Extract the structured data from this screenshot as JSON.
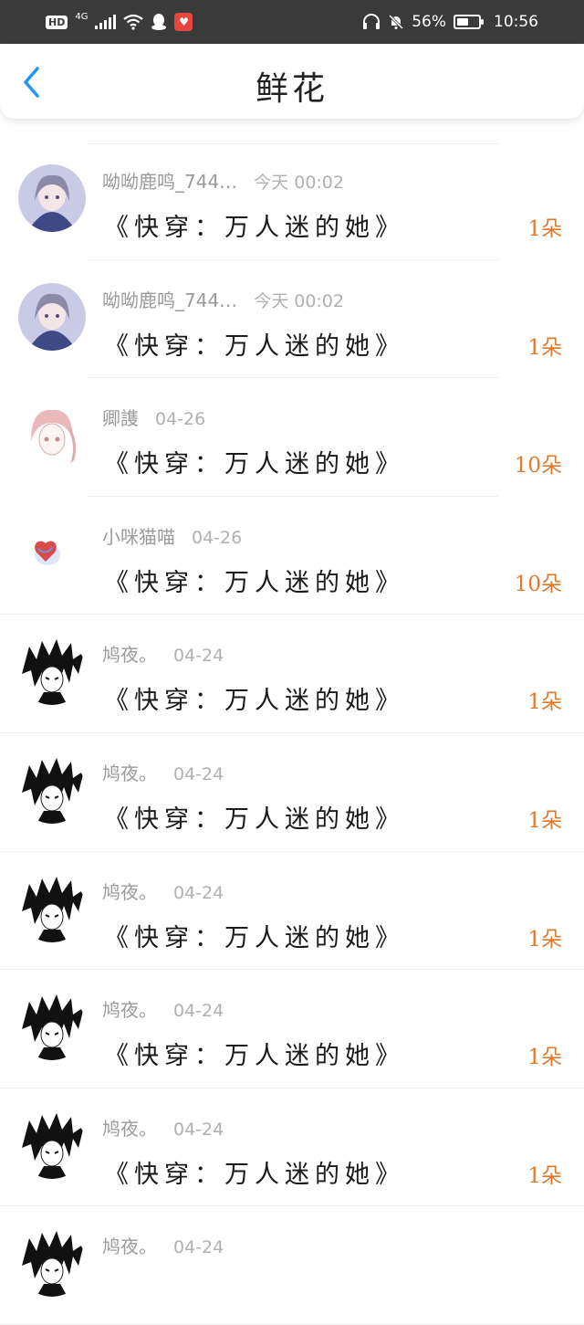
{
  "status_bar": {
    "hd": "HD",
    "network": "4G",
    "battery": "56%",
    "battery_level": 0.56,
    "time": "10:56"
  },
  "header": {
    "title": "鲜花"
  },
  "colors": {
    "accent": "#1e90ff",
    "amount": "#e07a2c"
  },
  "records": [
    {
      "user": "呦呦鹿鸣_744…",
      "time": "今天 00:02",
      "book": "《快穿：万人迷的她》",
      "amount": "1朵",
      "avatar": "anime-girl"
    },
    {
      "user": "呦呦鹿鸣_744…",
      "time": "今天 00:02",
      "book": "《快穿：万人迷的她》",
      "amount": "1朵",
      "avatar": "anime-girl"
    },
    {
      "user": "卿謢",
      "time": "04-26",
      "book": "《快穿：万人迷的她》",
      "amount": "10朵",
      "avatar": "sketch-girl"
    },
    {
      "user": "小咪猫喵",
      "time": "04-26",
      "book": "《快穿：万人迷的她》",
      "amount": "10朵",
      "avatar": "heart"
    },
    {
      "user": "鸠夜。",
      "time": "04-24",
      "book": "《快穿：万人迷的她》",
      "amount": "1朵",
      "avatar": "ink-boy"
    },
    {
      "user": "鸠夜。",
      "time": "04-24",
      "book": "《快穿：万人迷的她》",
      "amount": "1朵",
      "avatar": "ink-boy"
    },
    {
      "user": "鸠夜。",
      "time": "04-24",
      "book": "《快穿：万人迷的她》",
      "amount": "1朵",
      "avatar": "ink-boy"
    },
    {
      "user": "鸠夜。",
      "time": "04-24",
      "book": "《快穿：万人迷的她》",
      "amount": "1朵",
      "avatar": "ink-boy"
    },
    {
      "user": "鸠夜。",
      "time": "04-24",
      "book": "《快穿：万人迷的她》",
      "amount": "1朵",
      "avatar": "ink-boy"
    },
    {
      "user": "鸠夜。",
      "time": "04-24",
      "book": "",
      "amount": "",
      "avatar": "ink-boy"
    }
  ]
}
